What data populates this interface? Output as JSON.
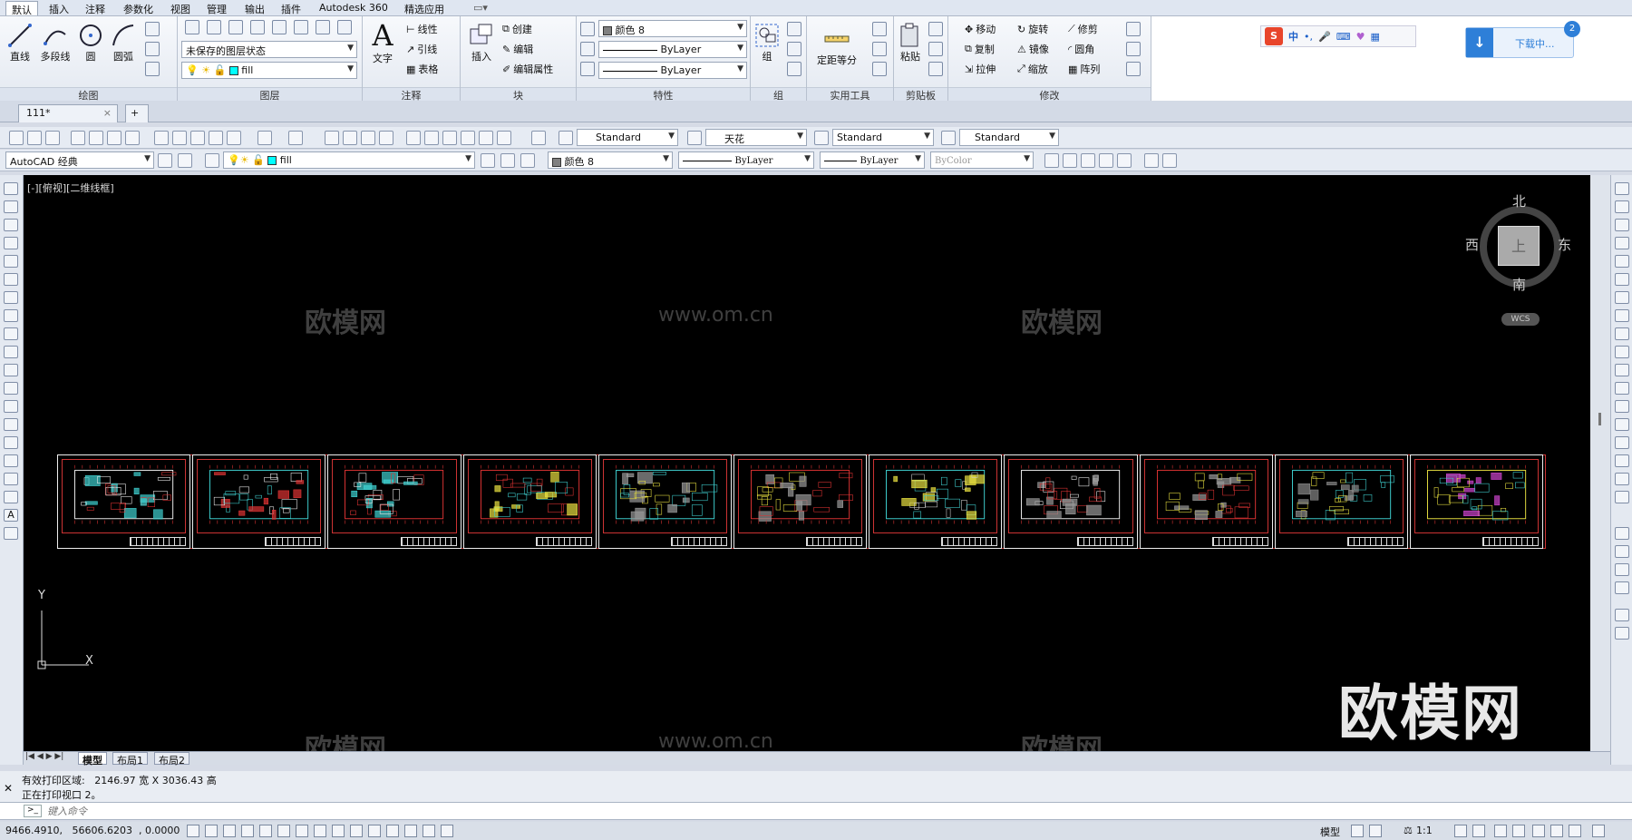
{
  "menubar": {
    "items": [
      "默认",
      "插入",
      "注释",
      "参数化",
      "视图",
      "管理",
      "输出",
      "插件",
      "Autodesk 360",
      "精选应用"
    ],
    "active": "默认"
  },
  "ribbon": {
    "draw": {
      "title": "绘图",
      "buttons": [
        "直线",
        "多段线",
        "圆",
        "圆弧"
      ]
    },
    "layers": {
      "title": "图层",
      "layer_state": "未保存的图层状态",
      "current_layer": "fill"
    },
    "annotation": {
      "title": "注释",
      "text_button": "文字",
      "items": [
        "线性",
        "引线",
        "表格"
      ]
    },
    "block": {
      "title": "块",
      "insert_button": "插入",
      "items": [
        "创建",
        "编辑",
        "编辑属性"
      ]
    },
    "properties": {
      "title": "特性",
      "color": "颜色 8",
      "linetype": "ByLayer",
      "lineweight": "ByLayer"
    },
    "groups": {
      "title": "组",
      "button": "组"
    },
    "utilities": {
      "title": "实用工具",
      "button": "定距等分"
    },
    "clipboard": {
      "title": "剪贴板",
      "button": "粘贴"
    },
    "modify": {
      "title": "修改",
      "items": [
        "移动",
        "旋转",
        "修剪",
        "复制",
        "镜像",
        "圆角",
        "拉伸",
        "缩放",
        "阵列"
      ]
    }
  },
  "ime": {
    "label": "中"
  },
  "download": {
    "label": "下载中...",
    "badge": "2"
  },
  "filetabs": {
    "tabs": [
      "111*"
    ]
  },
  "toolbar1": {
    "text_style": "Standard",
    "dim_style": "天花",
    "table_style": "Standard",
    "multileader_style": "Standard"
  },
  "toolbar2": {
    "workspace": "AutoCAD 经典",
    "layer": "fill",
    "color": "颜色 8",
    "linetype": "ByLayer",
    "lineweight": "ByLayer",
    "plotstyle": "ByColor"
  },
  "viewport": {
    "label": "[-][俯视][二维线框]",
    "compass": {
      "north": "北",
      "south": "南",
      "east": "东",
      "west": "西",
      "center": "上"
    },
    "ucs_button": "WCS",
    "axis_x": "X",
    "axis_y": "Y",
    "sheet_count": 11
  },
  "watermark": {
    "brand": "欧模网",
    "url": "www.om.cn"
  },
  "layout_tabs": {
    "tabs": [
      "模型",
      "布局1",
      "布局2"
    ],
    "active": "模型"
  },
  "command": {
    "history": [
      "有效打印区域:   2146.97 宽 X 3036.43 高",
      "正在打印视口 2。"
    ],
    "placeholder": "键入命令"
  },
  "status": {
    "coordinates": "9466.4910,   56606.6203  , 0.0000",
    "model_label": "模型",
    "scale": "1:1"
  },
  "colors": {
    "canvas": "#000000",
    "sheet_border": "#eeeeee",
    "accent": "#2e7fd8",
    "brand_ime": "#e8452b"
  }
}
